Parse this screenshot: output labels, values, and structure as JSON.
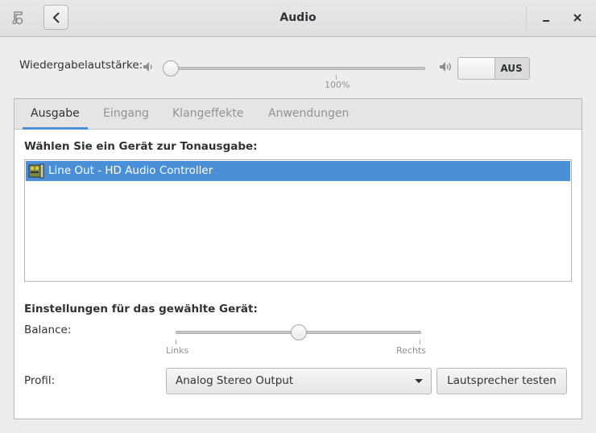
{
  "window": {
    "title": "Audio",
    "icons": {
      "app": "app-icon",
      "back": "go-back-icon",
      "minimize": "minimize-icon",
      "close": "close-icon"
    }
  },
  "volume": {
    "label": "Wiedergabelautstärke:",
    "level_fraction": 0.0,
    "mark_label": "100%",
    "mute_switch": {
      "state_label": "AUS",
      "on": false
    }
  },
  "tabs": [
    {
      "label": "Ausgabe",
      "active": true
    },
    {
      "label": "Eingang",
      "active": false
    },
    {
      "label": "Klangeffekte",
      "active": false
    },
    {
      "label": "Anwendungen",
      "active": false
    }
  ],
  "output": {
    "device_heading": "Wählen Sie ein Gerät zur Tonausgabe:",
    "devices": [
      {
        "name": "Line Out - HD Audio Controller",
        "selected": true,
        "icon": "audio-card-icon"
      }
    ],
    "settings_heading": "Einstellungen für das gewählte Gerät:",
    "balance": {
      "label": "Balance:",
      "left_label": "Links",
      "right_label": "Rechts",
      "value_fraction": 0.5
    },
    "profile": {
      "label": "Profil:",
      "selected": "Analog Stereo Output"
    },
    "test_button": "Lautsprecher testen"
  },
  "colors": {
    "accent": "#4a90d9",
    "background": "#ededed"
  }
}
